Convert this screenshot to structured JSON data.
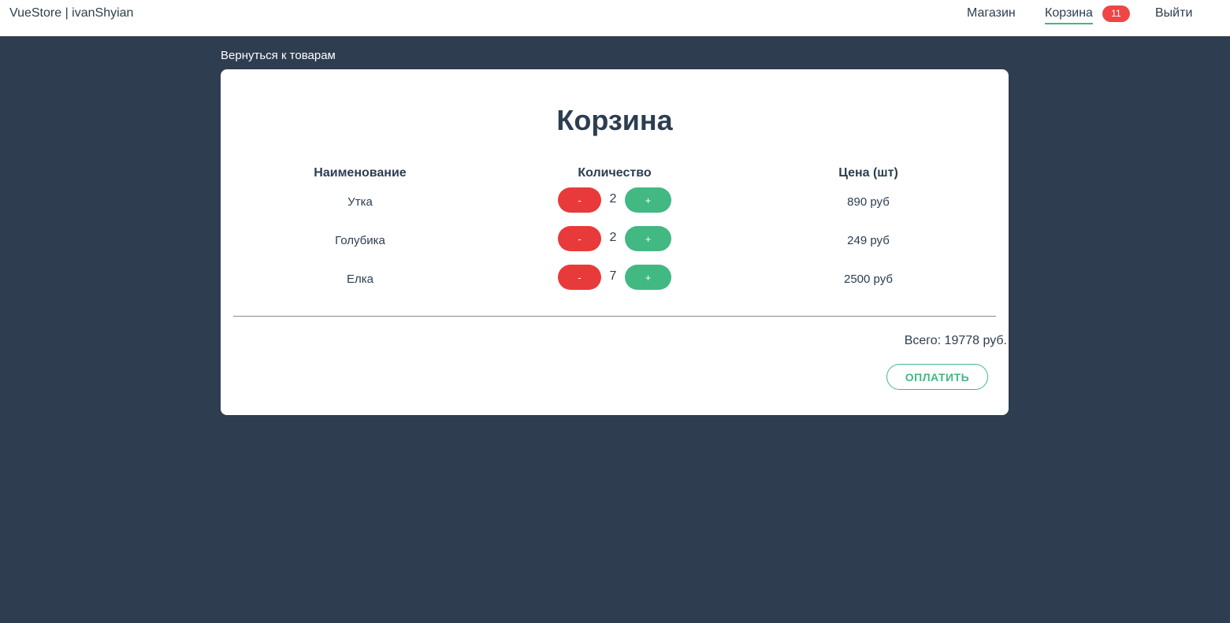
{
  "header": {
    "brand": "VueStore | ivanShyian",
    "nav": {
      "shop": "Магазин",
      "cart": "Корзина",
      "cart_count": "11",
      "logout": "Выйти"
    }
  },
  "back_link": "Вернуться к товарам",
  "cart": {
    "title": "Корзина",
    "columns": {
      "name": "Наименование",
      "qty": "Количество",
      "price": "Цена (шт)"
    },
    "items": [
      {
        "name": "Утка",
        "qty": "2",
        "price": "890 руб"
      },
      {
        "name": "Голубика",
        "qty": "2",
        "price": "249 руб"
      },
      {
        "name": "Елка",
        "qty": "7",
        "price": "2500 руб"
      }
    ],
    "minus_label": "-",
    "plus_label": "+",
    "total": "Всего: 19778 руб.",
    "pay_label": "ОПЛАТИТЬ"
  },
  "colors": {
    "accent": "#42b883",
    "danger": "#e83a3a",
    "badge": "#f04545",
    "background": "#2e3d50"
  }
}
